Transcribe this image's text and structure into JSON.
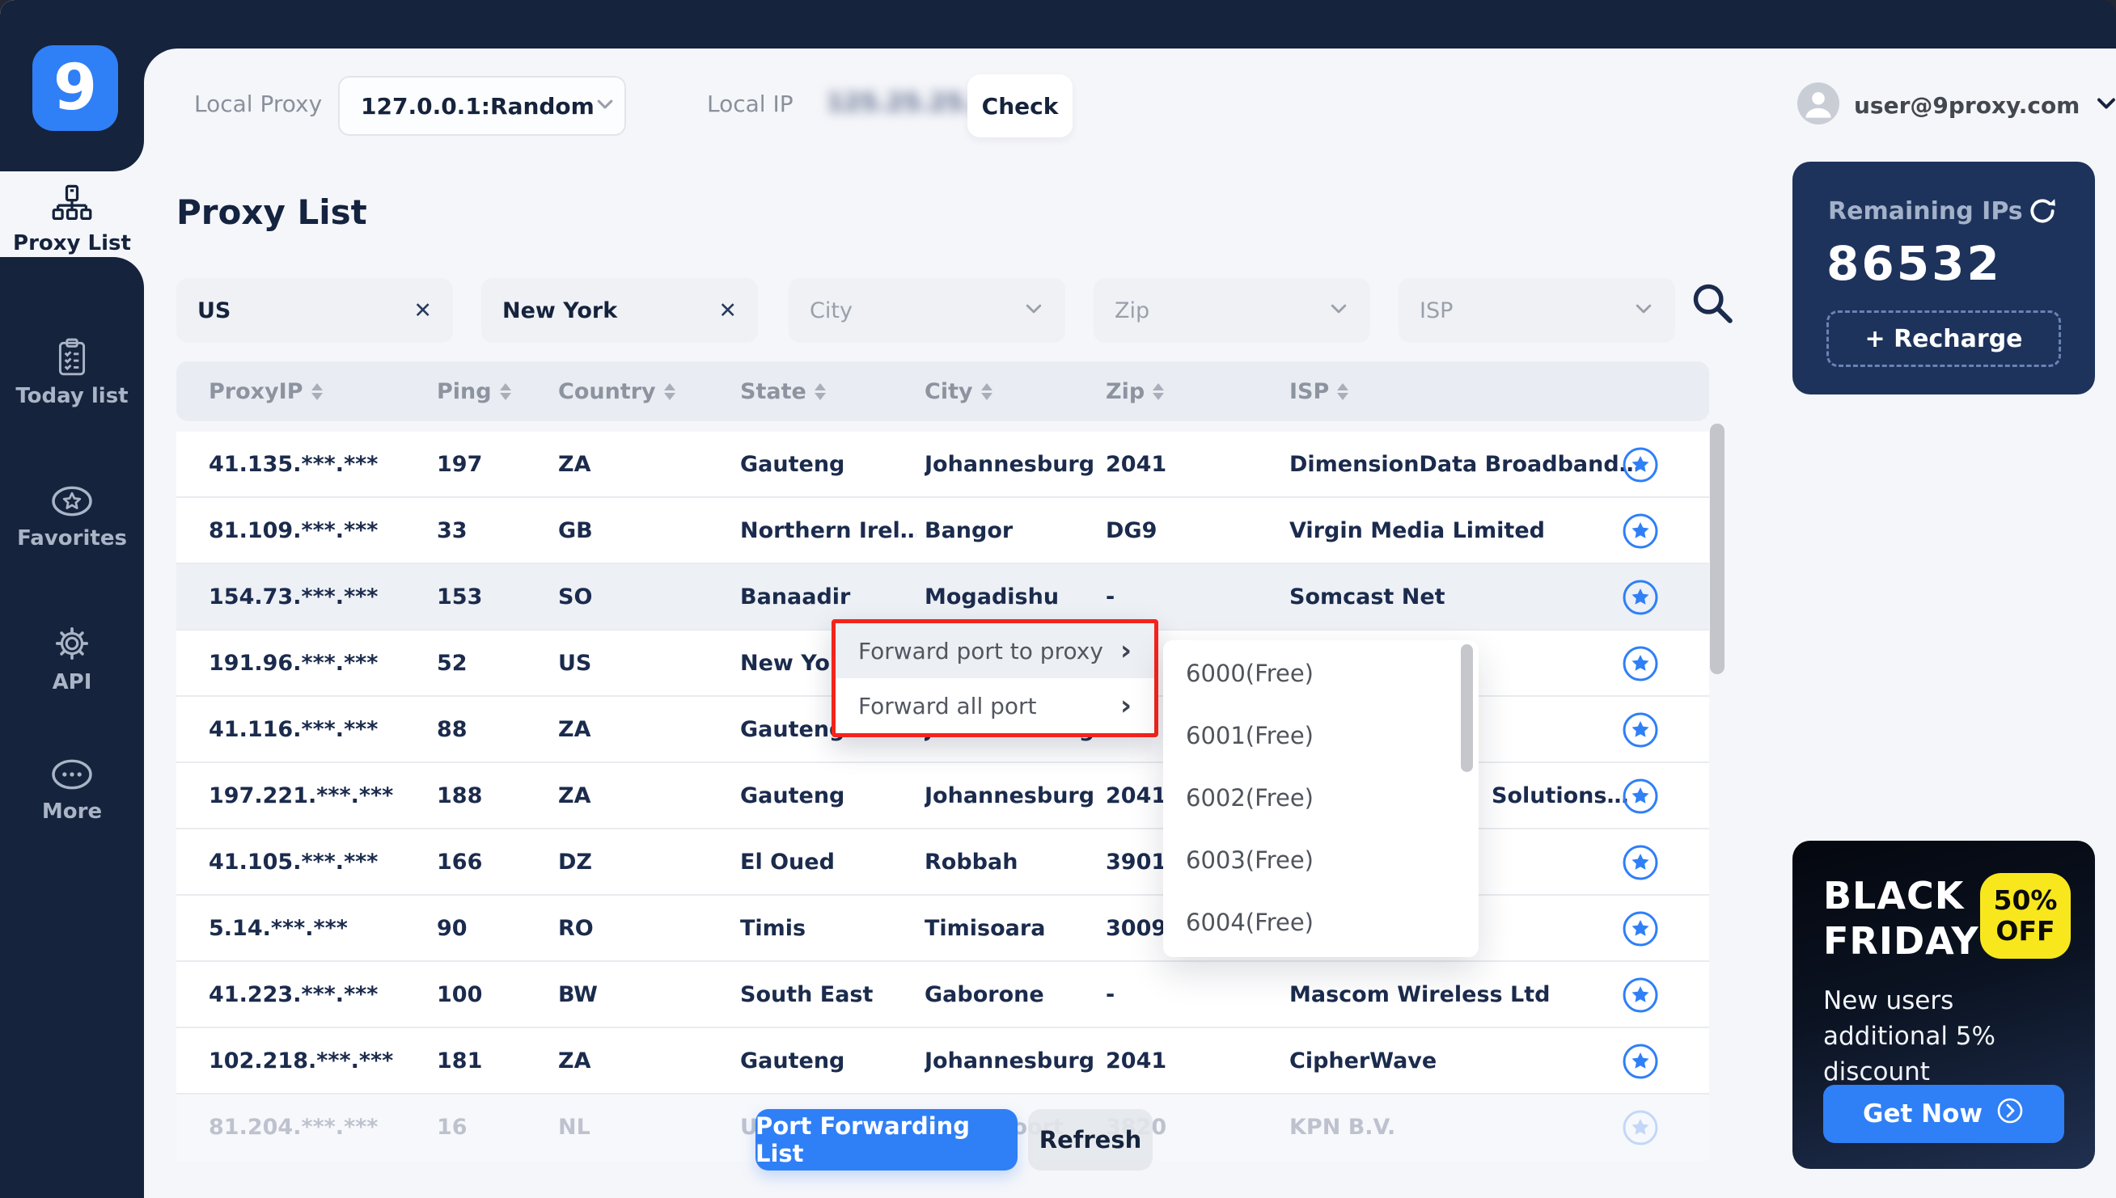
{
  "colors": {
    "accent_blue": "#2F7FF7",
    "navy": "#15233C",
    "card_navy": "#1D335C",
    "alert_red": "#F3241B",
    "promo_yellow": "#F8E71C",
    "bg_light": "#F5F6FA"
  },
  "topbar": {
    "local_proxy_label": "Local Proxy",
    "proxy_select_value": "127.0.0.1:Random",
    "local_ip_label": "Local IP",
    "local_ip_redacted": "125.25.25.125",
    "check_button": "Check",
    "user_email": "user@9proxy.com"
  },
  "sidebar": {
    "logo_text": "9",
    "items": [
      {
        "label": "Proxy List",
        "icon": "sitemap-icon",
        "active": true
      },
      {
        "label": "Today list",
        "icon": "clipboard-icon",
        "active": false
      },
      {
        "label": "Favorites",
        "icon": "star-oval-icon",
        "active": false
      },
      {
        "label": "API",
        "icon": "gear-icon",
        "active": false
      },
      {
        "label": "More",
        "icon": "ellipsis-icon",
        "active": false
      }
    ]
  },
  "main": {
    "title": "Proxy List",
    "filters": [
      {
        "value": "US",
        "kind": "clearable",
        "name": "filter-country"
      },
      {
        "value": "New York",
        "kind": "clearable",
        "name": "filter-state"
      },
      {
        "placeholder": "City",
        "kind": "select",
        "name": "filter-city"
      },
      {
        "placeholder": "Zip",
        "kind": "select",
        "name": "filter-zip"
      },
      {
        "placeholder": "ISP",
        "kind": "select",
        "name": "filter-isp"
      }
    ],
    "table": {
      "columns": [
        "ProxyIP",
        "Ping",
        "Country",
        "State",
        "City",
        "Zip",
        "ISP"
      ],
      "rows": [
        {
          "ip": "41.135.***.***",
          "ping": "197",
          "country": "ZA",
          "state": "Gauteng",
          "city": "Johannesburg",
          "zip": "2041",
          "isp": "DimensionData Broadband…"
        },
        {
          "ip": "81.109.***.***",
          "ping": "33",
          "country": "GB",
          "state": "Northern Irel…",
          "city": "Bangor",
          "zip": "DG9",
          "isp": "Virgin Media Limited"
        },
        {
          "ip": "154.73.***.***",
          "ping": "153",
          "country": "SO",
          "state": "Banaadir",
          "city": "Mogadishu",
          "zip": "-",
          "isp": "Somcast Net",
          "highlighted": true
        },
        {
          "ip": "191.96.***.***",
          "ping": "52",
          "country": "US",
          "state": "New York",
          "city": "",
          "zip": "",
          "isp": ""
        },
        {
          "ip": "41.116.***.***",
          "ping": "88",
          "country": "ZA",
          "state": "Gauteng",
          "city": "Johannesburg",
          "zip": "",
          "isp": ""
        },
        {
          "ip": "197.221.***.***",
          "ping": "188",
          "country": "ZA",
          "state": "Gauteng",
          "city": "Johannesburg",
          "zip": "2041",
          "isp": "Solutions…",
          "isp_pad": 250
        },
        {
          "ip": "41.105.***.***",
          "ping": "166",
          "country": "DZ",
          "state": "El Oued",
          "city": "Robbah",
          "zip": "3901",
          "isp": ""
        },
        {
          "ip": "5.14.***.***",
          "ping": "90",
          "country": "RO",
          "state": "Timis",
          "city": "Timisoara",
          "zip": "3009",
          "isp": ""
        },
        {
          "ip": "41.223.***.***",
          "ping": "100",
          "country": "BW",
          "state": "South East",
          "city": "Gaborone",
          "zip": "-",
          "isp": "Mascom Wireless Ltd"
        },
        {
          "ip": "102.218.***.***",
          "ping": "181",
          "country": "ZA",
          "state": "Gauteng",
          "city": "Johannesburg",
          "zip": "2041",
          "isp": "CipherWave"
        },
        {
          "ip": "81.204.***.***",
          "ping": "16",
          "country": "NL",
          "state": "Utrecht",
          "city": "Amersfoort",
          "zip": "3820",
          "isp": "KPN B.V.",
          "faded": true
        }
      ]
    },
    "footer_buttons": {
      "port_forwarding": "Port Forwarding List",
      "refresh": "Refresh"
    }
  },
  "context_menu": {
    "items": [
      {
        "label": "Forward port to proxy",
        "highlighted": true
      },
      {
        "label": "Forward all port",
        "highlighted": false
      }
    ]
  },
  "port_submenu": {
    "items": [
      "6000(Free)",
      "6001(Free)",
      "6002(Free)",
      "6003(Free)",
      "6004(Free)"
    ]
  },
  "right_panel": {
    "remaining_ips": {
      "label": "Remaining IPs",
      "value": "86532",
      "recharge_button": "+ Recharge"
    },
    "promo": {
      "title_line1": "BLACK",
      "title_line2": "FRIDAY",
      "badge_line1": "50%",
      "badge_line2": "OFF",
      "subtitle": "New users additional 5% discount",
      "cta": "Get Now"
    }
  }
}
